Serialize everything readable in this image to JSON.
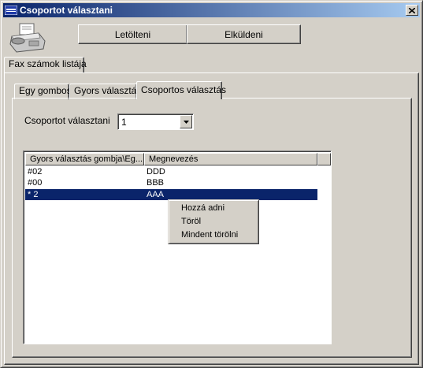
{
  "window": {
    "title": "Csoportot választani",
    "close_label": "X"
  },
  "toolbar": {
    "download_label": "Letölteni",
    "send_label": "Elküldeni"
  },
  "outer_tab": {
    "label": "Fax számok listája"
  },
  "tabs": [
    {
      "label": "Egy gombos"
    },
    {
      "label": "Gyors választás"
    },
    {
      "label": "Csoportos választás"
    }
  ],
  "group": {
    "label": "Csoportot választani",
    "selected_value": "1"
  },
  "list": {
    "columns": [
      "Gyors választás gombja\\Eg...",
      "Megnevezés"
    ],
    "rows": [
      {
        "key": "#02",
        "name": "DDD"
      },
      {
        "key": "#00",
        "name": "BBB"
      },
      {
        "key": "* 2",
        "name": "AAA"
      }
    ]
  },
  "context_menu": {
    "items": [
      "Hozzá adni",
      "Töröl",
      "Mindent törölni"
    ]
  },
  "colors": {
    "title_active": "#0a246a",
    "selection": "#0a246a",
    "face": "#d4d0c8"
  }
}
